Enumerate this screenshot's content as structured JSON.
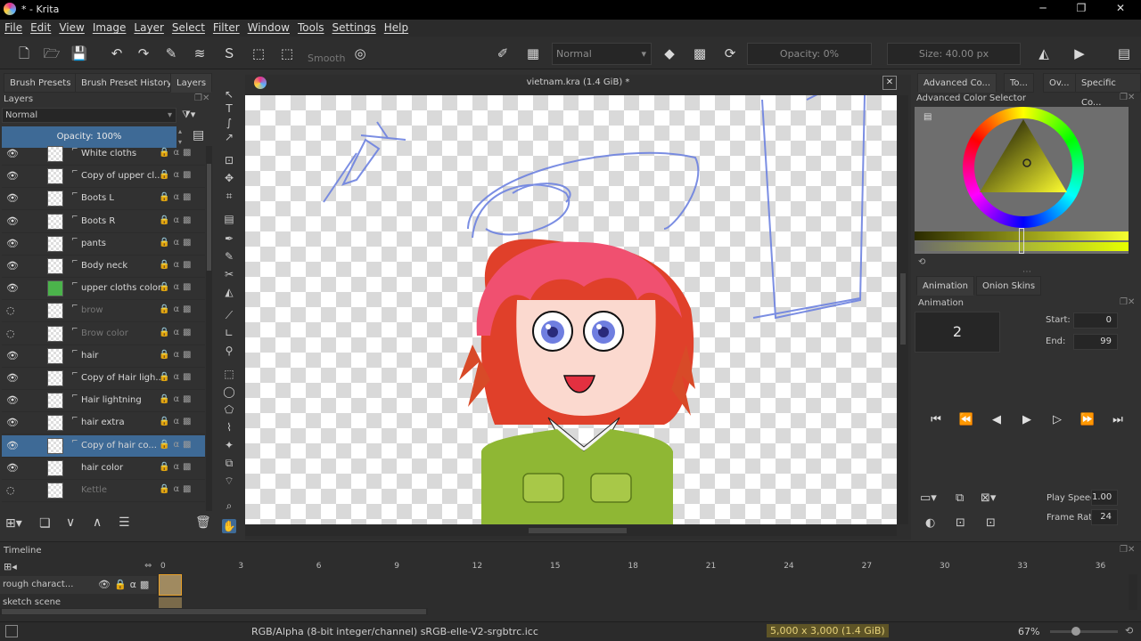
{
  "window": {
    "title": "* - Krita",
    "minimize": "─",
    "restore": "❐",
    "close": "✕"
  },
  "menu": [
    "File",
    "Edit",
    "View",
    "Image",
    "Layer",
    "Select",
    "Filter",
    "Window",
    "Tools",
    "Settings",
    "Help"
  ],
  "toolbar": {
    "smooth_label": "Smooth",
    "blend_mode": "Normal",
    "opacity": "Opacity: 0%",
    "size": "Size: 40.00 px"
  },
  "left_dock": {
    "tabs": [
      "Brush Presets",
      "Brush Preset History",
      "Layers"
    ],
    "layers_title": "Layers",
    "blend_mode": "Normal",
    "opacity": "Opacity:  100%",
    "layers": [
      {
        "name": "White cloths",
        "visible": true,
        "clip": true
      },
      {
        "name": "Copy of upper cl...",
        "visible": true,
        "clip": true
      },
      {
        "name": "Boots L",
        "visible": true,
        "clip": true
      },
      {
        "name": "Boots R",
        "visible": true,
        "clip": true
      },
      {
        "name": "pants",
        "visible": true,
        "clip": true
      },
      {
        "name": "Body neck",
        "visible": true,
        "clip": true
      },
      {
        "name": "upper cloths color",
        "visible": true,
        "clip": true
      },
      {
        "name": "brow",
        "visible": false,
        "clip": true
      },
      {
        "name": "Brow color",
        "visible": false,
        "clip": true
      },
      {
        "name": "hair",
        "visible": true,
        "clip": true
      },
      {
        "name": "Copy of Hair ligh...",
        "visible": true,
        "clip": true
      },
      {
        "name": "Hair lightning",
        "visible": true,
        "clip": true
      },
      {
        "name": "hair extra",
        "visible": true,
        "clip": true
      },
      {
        "name": "Copy of hair co...",
        "visible": true,
        "clip": true,
        "selected": true
      },
      {
        "name": "hair color",
        "visible": true,
        "clip": false
      },
      {
        "name": "Kettle",
        "visible": false,
        "clip": false
      }
    ]
  },
  "canvas": {
    "doc_title": "vietnam.kra (1.4 GiB) *"
  },
  "right_dock": {
    "tabs": [
      "Advanced Co...",
      "To...",
      "Ov...",
      "Specific Co..."
    ],
    "color_selector_title": "Advanced Color Selector",
    "anim_tabs": [
      "Animation",
      "Onion Skins"
    ],
    "animation_title": "Animation",
    "current_frame": "2",
    "start_label": "Start:",
    "start_value": "0",
    "end_label": "End:",
    "end_value": "99",
    "play_speed_label": "Play Speed:",
    "play_speed_value": "1.00",
    "frame_rate_label": "Frame Rate:",
    "frame_rate_value": "24"
  },
  "timeline": {
    "title": "Timeline",
    "ticks": [
      "0",
      "3",
      "6",
      "9",
      "12",
      "15",
      "18",
      "21",
      "24",
      "27",
      "30",
      "33",
      "36"
    ],
    "layers": [
      "rough charact...",
      "sketch scene"
    ]
  },
  "status": {
    "color_space": "RGB/Alpha (8-bit integer/channel)  sRGB-elle-V2-srgbtrc.icc",
    "dimensions": "5,000 x 3,000 (1.4 GiB)",
    "zoom": "67%"
  },
  "colors": {
    "accent": "#3e6a96",
    "fg_color": "#9aa64a",
    "bg_color": "#777777"
  }
}
